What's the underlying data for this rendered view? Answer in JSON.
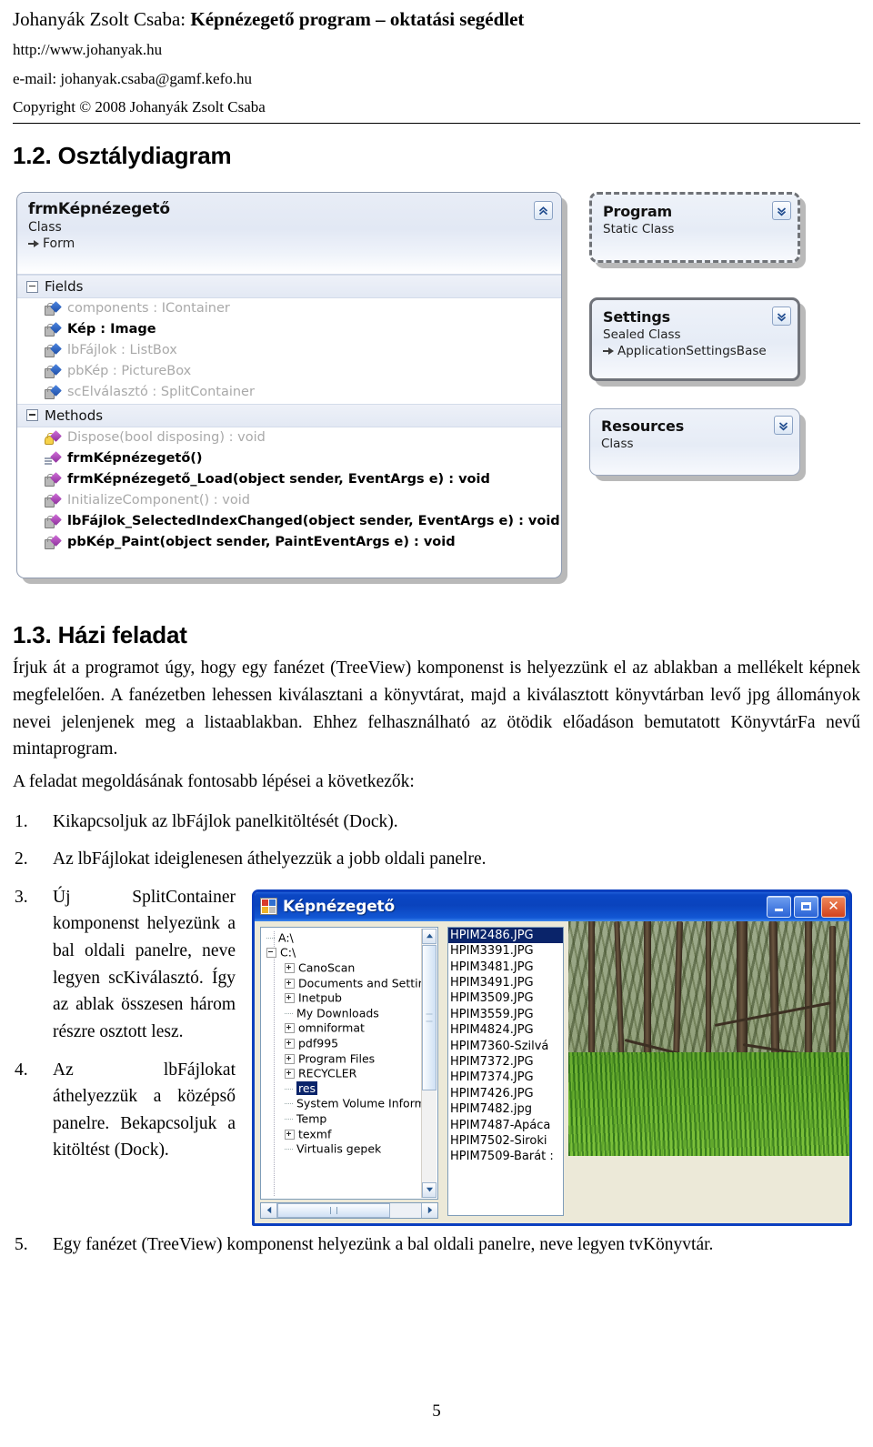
{
  "header": {
    "title_prefix": "Johanyák Zsolt Csaba: ",
    "title_bold": "Képnézegető program – oktatási segédlet",
    "url": "http://www.johanyak.hu",
    "email": "e-mail: johanyak.csaba@gamf.kefo.hu",
    "copyright": "Copyright © 2008 Johanyák Zsolt Csaba"
  },
  "sections": {
    "class_diagram_heading": "1.2. Osztálydiagram",
    "homework_heading": "1.3. Házi feladat"
  },
  "class_diagram": {
    "main": {
      "name": "frmKépnézegető",
      "kind": "Class",
      "base": "Form",
      "collapse_icon": "chevron-up-icon",
      "fields_label": "Fields",
      "methods_label": "Methods",
      "fields": [
        {
          "text": "components : IContainer",
          "dim": true,
          "icon": "private-field-icon"
        },
        {
          "text": "Kép : Image",
          "dim": false,
          "icon": "private-field-icon"
        },
        {
          "text": "lbFájlok : ListBox",
          "dim": true,
          "icon": "private-field-icon"
        },
        {
          "text": "pbKép : PictureBox",
          "dim": true,
          "icon": "private-field-icon"
        },
        {
          "text": "scElválasztó : SplitContainer",
          "dim": true,
          "icon": "private-field-icon"
        }
      ],
      "methods": [
        {
          "text": "Dispose(bool disposing) : void",
          "dim": true,
          "icon": "protected-method-icon"
        },
        {
          "text": "frmKépnézegető()",
          "dim": false,
          "icon": "public-method-icon"
        },
        {
          "text": "frmKépnézegető_Load(object sender, EventArgs e) : void",
          "dim": false,
          "icon": "private-method-icon"
        },
        {
          "text": "InitializeComponent() : void",
          "dim": true,
          "icon": "private-method-icon"
        },
        {
          "text": "lbFájlok_SelectedIndexChanged(object sender, EventArgs e) : void",
          "dim": false,
          "icon": "private-method-icon"
        },
        {
          "text": "pbKép_Paint(object sender, PaintEventArgs e) : void",
          "dim": false,
          "icon": "private-method-icon"
        }
      ]
    },
    "boxes": [
      {
        "name": "Program",
        "kind": "Static Class",
        "base": "",
        "collapse_icon": "chevron-down-icon"
      },
      {
        "name": "Settings",
        "kind": "Sealed Class",
        "base": "ApplicationSettingsBase",
        "collapse_icon": "chevron-down-icon"
      },
      {
        "name": "Resources",
        "kind": "Class",
        "base": "",
        "collapse_icon": "chevron-down-icon"
      }
    ]
  },
  "homework": {
    "intro": "Írjuk át a programot úgy, hogy egy fanézet (TreeView) komponenst is helyezzünk el az ablakban a mellékelt képnek megfelelően. A fanézetben lehessen kiválasztani a könyvtárat, majd a kiválasztott könyvtárban levő jpg állományok nevei jelenjenek meg a listaablakban. Ehhez felhasználható az ötödik előadáson bemutatott KönyvtárFa nevű mintaprogram.",
    "lead": "A feladat megoldásának fontosabb lépései a következők:",
    "steps": [
      {
        "num": "1.",
        "text": "Kikapcsoljuk az lbFájlok panelkitöltését (Dock)."
      },
      {
        "num": "2.",
        "text": "Az lbFájlokat ideiglenesen áthelyezzük a jobb oldali panelre."
      },
      {
        "num": "3.",
        "text": "Új SplitContainer komponenst helyezünk a bal oldali panelre, neve legyen scKiválasztó. Így az ablak összesen három részre osztott lesz."
      },
      {
        "num": "4.",
        "text": "Az lbFájlokat áthelyezzük a középső panelre. Bekapcsoljuk a kitöltést (Dock)."
      },
      {
        "num": "5.",
        "text": "Egy fanézet (TreeView) komponenst helyezünk a bal oldali panelre, neve legyen tvKönyvtár."
      }
    ]
  },
  "app_window": {
    "title": "Képnézegető",
    "app_icon": "application-icon",
    "buttons": {
      "minimize": "minimize-icon",
      "maximize": "maximize-icon",
      "close": "close-icon"
    },
    "tree": [
      {
        "label": "A:\\",
        "indent": 1,
        "toggle": "none",
        "selected": false
      },
      {
        "label": "C:\\",
        "indent": 1,
        "toggle": "minus",
        "selected": false
      },
      {
        "label": "CanoScan",
        "indent": 2,
        "toggle": "plus",
        "selected": false
      },
      {
        "label": "Documents and Settir",
        "indent": 2,
        "toggle": "plus",
        "selected": false
      },
      {
        "label": "Inetpub",
        "indent": 2,
        "toggle": "plus",
        "selected": false
      },
      {
        "label": "My Downloads",
        "indent": 2,
        "toggle": "none",
        "selected": false
      },
      {
        "label": "omniformat",
        "indent": 2,
        "toggle": "plus",
        "selected": false
      },
      {
        "label": "pdf995",
        "indent": 2,
        "toggle": "plus",
        "selected": false
      },
      {
        "label": "Program Files",
        "indent": 2,
        "toggle": "plus",
        "selected": false
      },
      {
        "label": "RECYCLER",
        "indent": 2,
        "toggle": "plus",
        "selected": false
      },
      {
        "label": "res",
        "indent": 2,
        "toggle": "none",
        "selected": true
      },
      {
        "label": "System Volume Inform",
        "indent": 2,
        "toggle": "none",
        "selected": false
      },
      {
        "label": "Temp",
        "indent": 2,
        "toggle": "none",
        "selected": false
      },
      {
        "label": "texmf",
        "indent": 2,
        "toggle": "plus",
        "selected": false
      },
      {
        "label": "Virtualis gepek",
        "indent": 2,
        "toggle": "none",
        "selected": false
      }
    ],
    "files": [
      {
        "name": "HPIM2486.JPG",
        "selected": true
      },
      {
        "name": "HPIM3391.JPG",
        "selected": false
      },
      {
        "name": "HPIM3481.JPG",
        "selected": false
      },
      {
        "name": "HPIM3491.JPG",
        "selected": false
      },
      {
        "name": "HPIM3509.JPG",
        "selected": false
      },
      {
        "name": "HPIM3559.JPG",
        "selected": false
      },
      {
        "name": "HPIM4824.JPG",
        "selected": false
      },
      {
        "name": "HPIM7360-Szilvá",
        "selected": false
      },
      {
        "name": "HPIM7372.JPG",
        "selected": false
      },
      {
        "name": "HPIM7374.JPG",
        "selected": false
      },
      {
        "name": "HPIM7426.JPG",
        "selected": false
      },
      {
        "name": "HPIM7482.jpg",
        "selected": false
      },
      {
        "name": "HPIM7487-Apáca",
        "selected": false
      },
      {
        "name": "HPIM7502-Siroki",
        "selected": false
      },
      {
        "name": "HPIM7509-Barát :",
        "selected": false
      }
    ],
    "picture_alt": "forest-photo"
  },
  "footer": {
    "page_number": "5"
  }
}
